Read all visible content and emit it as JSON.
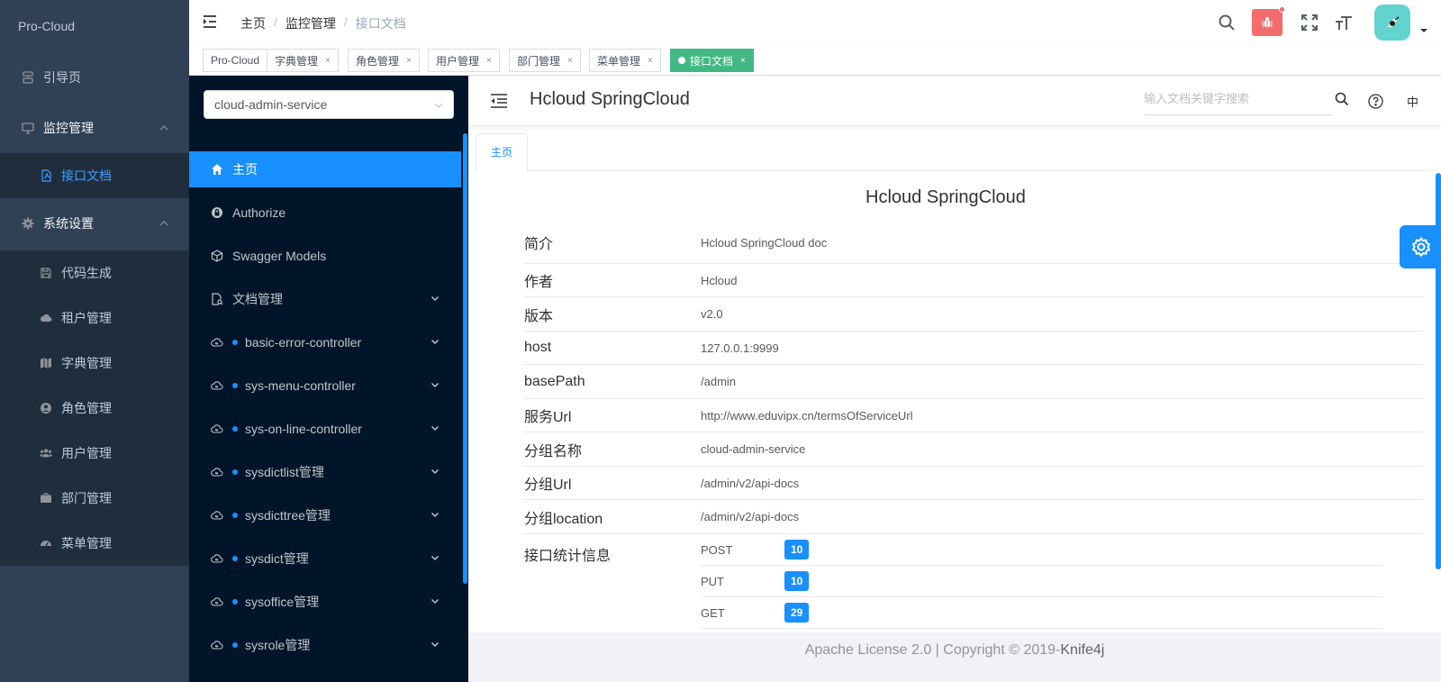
{
  "app": {
    "title": "Pro-Cloud"
  },
  "sidebar": {
    "items": [
      {
        "label": "引导页",
        "icon": "guide-icon"
      },
      {
        "label": "监控管理",
        "icon": "monitor-icon"
      },
      {
        "label": "接口文档",
        "icon": "pdf-icon"
      },
      {
        "label": "系统设置",
        "icon": "gear-icon"
      },
      {
        "label": "代码生成",
        "icon": "save-icon"
      },
      {
        "label": "租户管理",
        "icon": "cloud-icon"
      },
      {
        "label": "字典管理",
        "icon": "map-icon"
      },
      {
        "label": "角色管理",
        "icon": "user-circle-icon"
      },
      {
        "label": "用户管理",
        "icon": "users-icon"
      },
      {
        "label": "部门管理",
        "icon": "briefcase-icon"
      },
      {
        "label": "菜单管理",
        "icon": "dashboard-icon"
      }
    ]
  },
  "breadcrumb": {
    "items": [
      "主页",
      "监控管理",
      "接口文档"
    ]
  },
  "tags": {
    "items": [
      "Pro-Cloud",
      "字典管理",
      "角色管理",
      "用户管理",
      "部门管理",
      "菜单管理",
      "接口文档"
    ]
  },
  "doc": {
    "service_select": "cloud-admin-service",
    "menu": [
      {
        "label": "主页"
      },
      {
        "label": "Authorize"
      },
      {
        "label": "Swagger Models"
      },
      {
        "label": "文档管理"
      },
      {
        "label": "basic-error-controller"
      },
      {
        "label": "sys-menu-controller"
      },
      {
        "label": "sys-on-line-controller"
      },
      {
        "label": "sysdictlist管理"
      },
      {
        "label": "sysdicttree管理"
      },
      {
        "label": "sysdict管理"
      },
      {
        "label": "sysoffice管理"
      },
      {
        "label": "sysrole管理"
      }
    ],
    "header_title": "Hcloud SpringCloud",
    "search_placeholder": "输入文档关键字搜索",
    "lang": "中",
    "tab": "主页",
    "title": "Hcloud SpringCloud",
    "info": [
      {
        "key": "简介",
        "value": "Hcloud SpringCloud doc"
      },
      {
        "key": "作者",
        "value": "Hcloud"
      },
      {
        "key": "版本",
        "value": "v2.0"
      },
      {
        "key": "host",
        "value": "127.0.0.1:9999"
      },
      {
        "key": "basePath",
        "value": "/admin"
      },
      {
        "key": "服务Url",
        "value": "http://www.eduvipx.cn/termsOfServiceUrl"
      },
      {
        "key": "分组名称",
        "value": "cloud-admin-service"
      },
      {
        "key": "分组Url",
        "value": "/admin/v2/api-docs"
      },
      {
        "key": "分组location",
        "value": "/admin/v2/api-docs"
      }
    ],
    "stats_label": "接口统计信息",
    "stats": [
      {
        "method": "POST",
        "count": "10"
      },
      {
        "method": "PUT",
        "count": "10"
      },
      {
        "method": "GET",
        "count": "29"
      }
    ],
    "footer": {
      "license": "Apache License 2.0 | Copyright ",
      "copy_symbol": "©",
      "year": " 2019-",
      "brand": "Knife4j"
    }
  },
  "colors": {
    "sidebar_bg": "#304156",
    "doc_sidebar_bg": "#001529",
    "accent": "#1890ff",
    "active_tag": "#42b983",
    "bug": "#f56c6c"
  }
}
